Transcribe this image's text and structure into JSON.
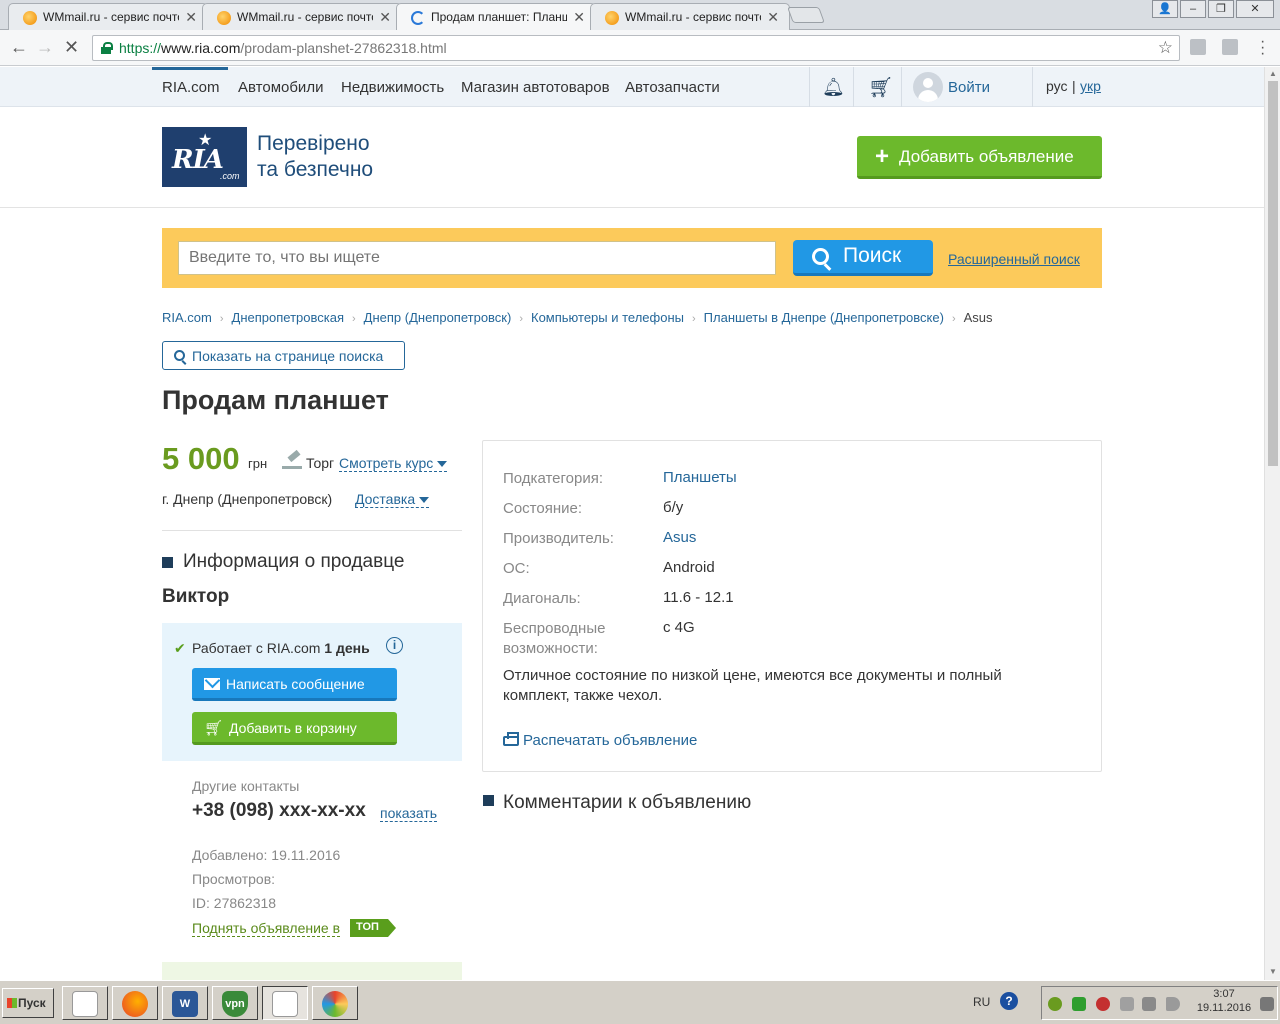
{
  "browser": {
    "tabs": [
      {
        "title": "WMmail.ru - сервис почтов",
        "active": false
      },
      {
        "title": "WMmail.ru - сервис почтов",
        "active": false
      },
      {
        "title": "Продам планшет: Планше",
        "active": true
      },
      {
        "title": "WMmail.ru - сервис почтов",
        "active": false
      }
    ],
    "url": {
      "protocol": "https://",
      "host": "www.ria.com",
      "path": "/prodam-planshet-27862318.html"
    }
  },
  "topnav": {
    "items": [
      "RIA.com",
      "Автомобили",
      "Недвижимость",
      "Магазин автотоваров",
      "Автозапчасти"
    ],
    "login": "Войти",
    "lang_ru": "рус",
    "lang_sep": "|",
    "lang_uk": "укр"
  },
  "header": {
    "logo_text": "RIA",
    "logo_com": ".com",
    "slogan_line1": "Перевірено",
    "slogan_line2": "та безпечно",
    "add_button": "Добавить объявление"
  },
  "search": {
    "placeholder": "Введите то, что вы ищете",
    "button": "Поиск",
    "advanced": "Расширенный поиск"
  },
  "breadcrumb": [
    "RIA.com",
    "Днепропетровская",
    "Днепр (Днепропетровск)",
    "Компьютеры и телефоны",
    "Планшеты в Днепре (Днепропетровске)",
    "Asus"
  ],
  "show_on_search": "Показать на странице поиска",
  "ad": {
    "title": "Продам планшет",
    "price": "5 000",
    "currency": "грн",
    "bargain": "Торг",
    "rate_link": "Смотреть курс",
    "city": "г. Днепр (Днепропетровск)",
    "delivery": "Доставка"
  },
  "seller": {
    "heading": "Информация о продавце",
    "name": "Виктор",
    "works_prefix": "Работает с RIA.com",
    "works_duration": "1 день",
    "message_button": "Написать сообщение",
    "cart_button": "Добавить в корзину",
    "other_contacts": "Другие контакты",
    "phone": "+38 (098) xxx-xx-xx",
    "show_phone": "показать",
    "added": "Добавлено: 19.11.2016",
    "views": "Просмотров:",
    "id": "ID: 27862318",
    "raise": "Поднять объявление в",
    "top_badge": "ТОП"
  },
  "details": {
    "rows": [
      {
        "label": "Подкатегория:",
        "value": "Планшеты",
        "link": true
      },
      {
        "label": "Состояние:",
        "value": "б/у",
        "link": false
      },
      {
        "label": "Производитель:",
        "value": "Asus",
        "link": true
      },
      {
        "label": "ОС:",
        "value": "Android",
        "link": false
      },
      {
        "label": "Диагональ:",
        "value": "11.6 - 12.1",
        "link": false
      },
      {
        "label": "Беспроводные возможности:",
        "value": "с 4G",
        "link": false
      }
    ],
    "description": "Отличное состояние по низкой цене, имеются все документы и полный комплект, также чехол.",
    "print": "Распечатать объявление"
  },
  "comments_heading": "Комментарии к объявлению",
  "taskbar": {
    "start": "Пуск",
    "lang": "RU",
    "time": "3:07",
    "date": "19.11.2016",
    "vpn_label": "vpn",
    "word_label": "W"
  },
  "colors": {
    "brand_blue": "#256799",
    "green": "#6cb92c",
    "search_yellow": "#fcca5b",
    "button_blue": "#2198e5"
  }
}
